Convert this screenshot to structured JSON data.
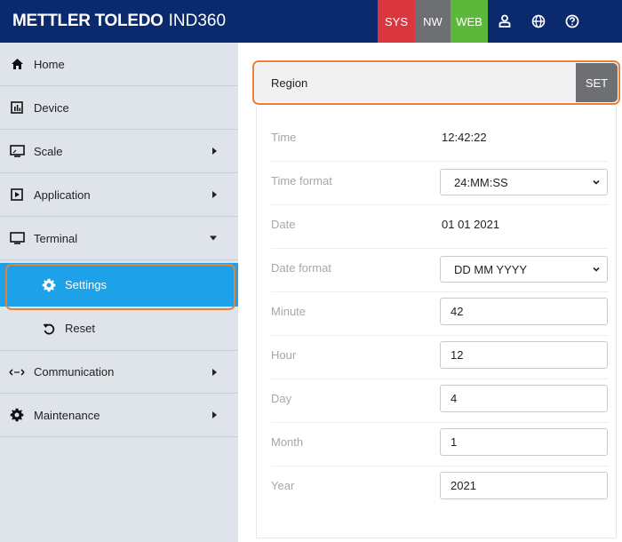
{
  "header": {
    "brand": "METTLER TOLEDO",
    "model": "IND360",
    "buttons": {
      "sys": "SYS",
      "nw": "NW",
      "web": "WEB"
    },
    "icons": [
      "user-icon",
      "globe-icon",
      "help-icon"
    ],
    "colors": {
      "bar": "#0b2a6e",
      "sys": "#d9363e",
      "nw": "#6d6f73",
      "web": "#5cb83a"
    }
  },
  "sidebar": {
    "items": [
      {
        "label": "Home",
        "icon": "home-icon"
      },
      {
        "label": "Device",
        "icon": "device-chart-icon"
      },
      {
        "label": "Scale",
        "icon": "scale-display-icon",
        "submenu": true
      },
      {
        "label": "Application",
        "icon": "application-play-icon",
        "submenu": true
      },
      {
        "label": "Terminal",
        "icon": "terminal-monitor-icon",
        "expanded": true
      },
      {
        "label": "Communication",
        "icon": "communication-arrows-icon",
        "submenu": true
      },
      {
        "label": "Maintenance",
        "icon": "maintenance-gear-icon",
        "submenu": true
      }
    ],
    "terminal_sub": [
      {
        "label": "Settings",
        "icon": "gear-icon",
        "active": true
      },
      {
        "label": "Reset",
        "icon": "reset-icon"
      }
    ],
    "active_color": "#1da1e8"
  },
  "main": {
    "section_title": "Region",
    "set_label": "SET",
    "fields": {
      "time": {
        "label": "Time",
        "value": "12:42:22"
      },
      "time_format": {
        "label": "Time format",
        "value": "24:MM:SS"
      },
      "date": {
        "label": "Date",
        "value": "01 01 2021"
      },
      "date_format": {
        "label": "Date format",
        "value": "DD MM YYYY"
      },
      "minute": {
        "label": "Minute",
        "value": "42"
      },
      "hour": {
        "label": "Hour",
        "value": "12"
      },
      "day": {
        "label": "Day",
        "value": "4"
      },
      "month": {
        "label": "Month",
        "value": "1"
      },
      "year": {
        "label": "Year",
        "value": "2021"
      }
    }
  },
  "highlight_color": "#e8803a"
}
